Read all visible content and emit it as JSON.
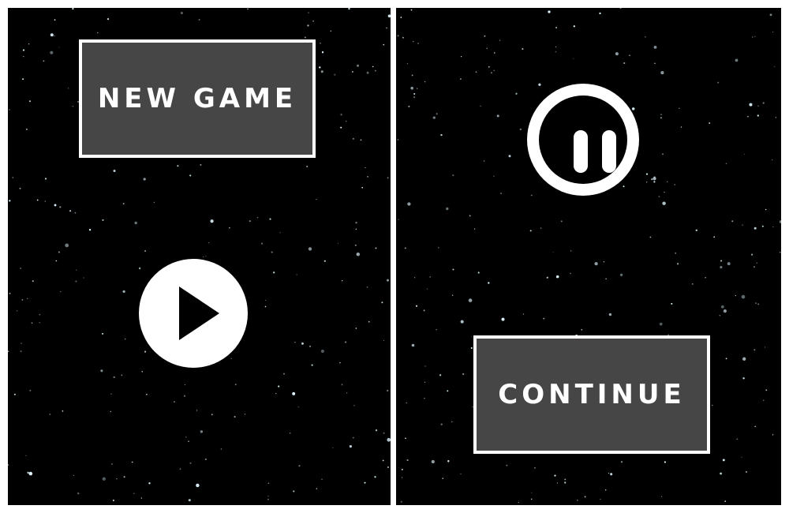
{
  "left_screen": {
    "new_game_label": "NEW GAME",
    "play_icon": "play-icon"
  },
  "right_screen": {
    "continue_label": "CONTINUE",
    "pause_icon": "pause-icon"
  },
  "colors": {
    "background": "#000000",
    "button_fill": "#464646",
    "button_border": "#ffffff",
    "text": "#ffffff",
    "star": "#dff6ff"
  }
}
